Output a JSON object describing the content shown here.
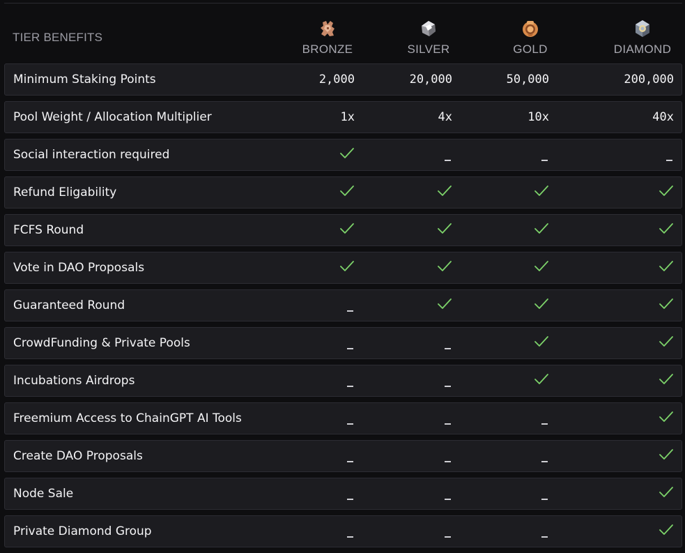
{
  "header": {
    "title": "TIER BENEFITS",
    "tiers": [
      {
        "name": "BRONZE",
        "icon": "bronze-tier-icon",
        "color": "#c98a6a"
      },
      {
        "name": "SILVER",
        "icon": "silver-tier-icon",
        "color": "#b8b8bc"
      },
      {
        "name": "GOLD",
        "icon": "gold-tier-icon",
        "color": "#d88a4a"
      },
      {
        "name": "DIAMOND",
        "icon": "diamond-tier-icon",
        "color": "#9aa6b4"
      }
    ]
  },
  "colors": {
    "check": "#7dd36a",
    "row_bg": "#1c1c20",
    "page_bg": "#0e0e10"
  },
  "rows": [
    {
      "label": "Minimum Staking Points",
      "values": [
        "2,000",
        "20,000",
        "50,000",
        "200,000"
      ]
    },
    {
      "label": "Pool Weight / Allocation Multiplier",
      "values": [
        "1x",
        "4x",
        "10x",
        "40x"
      ]
    },
    {
      "label": "Social interaction required",
      "values": [
        "check",
        "dash",
        "dash",
        "dash"
      ]
    },
    {
      "label": "Refund Eligability",
      "values": [
        "check",
        "check",
        "check",
        "check"
      ]
    },
    {
      "label": "FCFS Round",
      "values": [
        "check",
        "check",
        "check",
        "check"
      ]
    },
    {
      "label": "Vote in DAO Proposals",
      "values": [
        "check",
        "check",
        "check",
        "check"
      ]
    },
    {
      "label": "Guaranteed Round",
      "values": [
        "dash",
        "check",
        "check",
        "check"
      ]
    },
    {
      "label": "CrowdFunding & Private Pools",
      "values": [
        "dash",
        "dash",
        "check",
        "check"
      ]
    },
    {
      "label": "Incubations Airdrops",
      "values": [
        "dash",
        "dash",
        "check",
        "check"
      ]
    },
    {
      "label": "Freemium Access to ChainGPT AI Tools",
      "values": [
        "dash",
        "dash",
        "dash",
        "check"
      ]
    },
    {
      "label": "Create DAO Proposals",
      "values": [
        "dash",
        "dash",
        "dash",
        "check"
      ]
    },
    {
      "label": "Node Sale",
      "values": [
        "dash",
        "dash",
        "dash",
        "check"
      ]
    },
    {
      "label": "Private Diamond Group",
      "values": [
        "dash",
        "dash",
        "dash",
        "check"
      ]
    }
  ]
}
